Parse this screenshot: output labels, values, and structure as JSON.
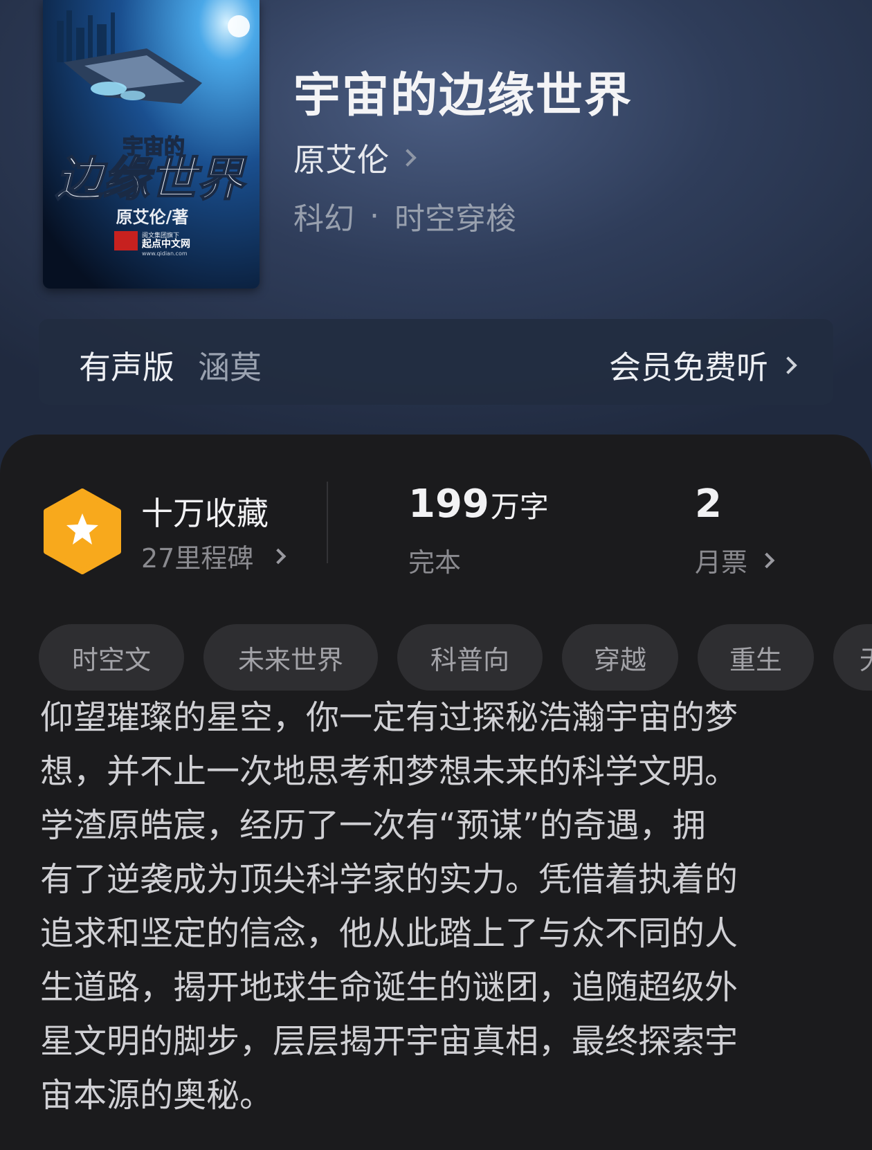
{
  "book": {
    "title": "宇宙的边缘世界",
    "author": "原艾伦",
    "category": "科幻",
    "subcategory": "时空穿梭",
    "separator": "·"
  },
  "cover": {
    "title_small": "宇宙的",
    "title_large": "边缘世界",
    "author_credit": "原艾伦/著",
    "publisher": "起点中文网",
    "publisher_tagline": "阅文集团旗下",
    "publisher_url": "www.qidian.com"
  },
  "audio": {
    "label": "有声版",
    "narrator": "涵莫",
    "action": "会员免费听"
  },
  "stats": {
    "collection": "十万收藏",
    "milestones": "27里程碑",
    "word_count": "199",
    "word_unit": "万字",
    "status": "完本",
    "monthly_votes": "2",
    "monthly_votes_label": "月票"
  },
  "tags": [
    "时空文",
    "未来世界",
    "科普向",
    "穿越",
    "重生",
    "无"
  ],
  "description_lines": [
    "仰望璀璨的星空，你一定有过探秘浩瀚宇宙的梦",
    "想，并不止一次地思考和梦想未来的科学文明。",
    "学渣原皓宸，经历了一次有“预谋”的奇遇，拥",
    "有了逆袭成为顶尖科学家的实力。凭借着执着的",
    "追求和坚定的信念，他从此踏上了与众不同的人",
    "生道路，揭开地球生命诞生的谜团，追随超级外",
    "星文明的脚步，层层揭开宇宙真相，最终探索宇",
    "宙本源的奥秘。"
  ],
  "colors": {
    "hero_top": "#4b5d82",
    "hero_bottom": "#202a3f",
    "panel_bg": "#1b1b1d",
    "badge_orange": "#f8a91c",
    "tag_bg": "#2e2e31"
  }
}
